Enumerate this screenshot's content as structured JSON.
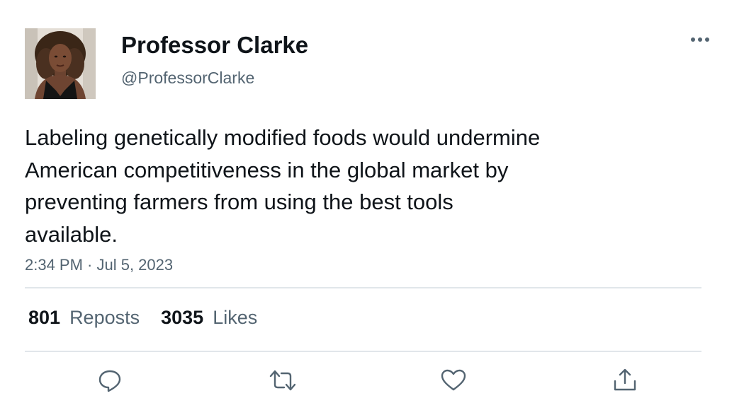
{
  "author": {
    "display_name": "Professor Clarke",
    "handle": "@ProfessorClarke"
  },
  "tweet": {
    "text": "Labeling genetically modified foods would undermine\nAmerican competitiveness in the global market by\npreventing farmers from using the best tools\navailable.",
    "timestamp": "2:34 PM · Jul 5, 2023"
  },
  "stats": {
    "reposts_count": "801",
    "reposts_label": "Reposts",
    "likes_count": "3035",
    "likes_label": "Likes"
  },
  "icons": {
    "more": "more-horizontal-icon",
    "reply": "reply-bubble-icon",
    "repost": "repost-arrows-icon",
    "like": "heart-icon",
    "share": "share-upload-icon"
  },
  "colors": {
    "primary_text": "#0f1419",
    "secondary_text": "#536471",
    "divider": "#e1e6ea"
  }
}
